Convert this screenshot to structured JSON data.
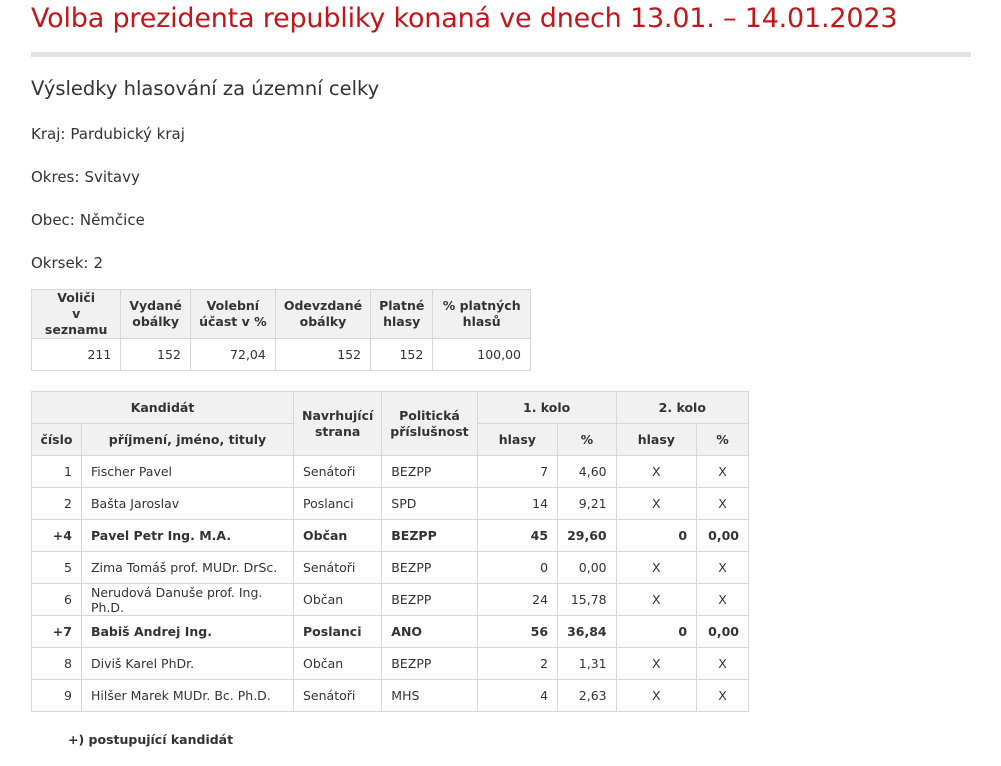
{
  "title": "Volba prezidenta republiky konaná ve dnech 13.01. – 14.01.2023",
  "subtitle": "Výsledky hlasování za územní celky",
  "location": [
    {
      "label": "Kraj:",
      "value": "Pardubický kraj"
    },
    {
      "label": "Okres:",
      "value": "Svitavy"
    },
    {
      "label": "Obec:",
      "value": "Němčice"
    },
    {
      "label": "Okrsek:",
      "value": "2"
    }
  ],
  "summary": {
    "headers": [
      [
        "Voliči",
        "v seznamu"
      ],
      [
        "Vydané",
        "obálky"
      ],
      [
        "Volební",
        "účast v %"
      ],
      [
        "Odevzdané",
        "obálky"
      ],
      [
        "Platné",
        "hlasy"
      ],
      [
        "% platných",
        "hlasů"
      ]
    ],
    "values": [
      "211",
      "152",
      "72,04",
      "152",
      "152",
      "100,00"
    ]
  },
  "results": {
    "header_candidate": "Kandidát",
    "header_number": "číslo",
    "header_name": "příjmení, jméno, tituly",
    "header_party": [
      "Navrhující",
      "strana"
    ],
    "header_affiliation": [
      "Politická",
      "příslušnost"
    ],
    "header_round1": "1. kolo",
    "header_round2": "2. kolo",
    "header_votes": "hlasy",
    "header_percent": "%",
    "rows": [
      {
        "num": "1",
        "name": "Fischer Pavel",
        "party": "Senátoři",
        "affil": "BEZPP",
        "v1": "7",
        "p1": "4,60",
        "v2": "X",
        "p2": "X",
        "bold": false
      },
      {
        "num": "2",
        "name": "Bašta Jaroslav",
        "party": "Poslanci",
        "affil": "SPD",
        "v1": "14",
        "p1": "9,21",
        "v2": "X",
        "p2": "X",
        "bold": false
      },
      {
        "num": "+4",
        "name": "Pavel Petr Ing. M.A.",
        "party": "Občan",
        "affil": "BEZPP",
        "v1": "45",
        "p1": "29,60",
        "v2": "0",
        "p2": "0,00",
        "bold": true
      },
      {
        "num": "5",
        "name": "Zima Tomáš prof. MUDr. DrSc.",
        "party": "Senátoři",
        "affil": "BEZPP",
        "v1": "0",
        "p1": "0,00",
        "v2": "X",
        "p2": "X",
        "bold": false
      },
      {
        "num": "6",
        "name": "Nerudová Danuše prof. Ing. Ph.D.",
        "party": "Občan",
        "affil": "BEZPP",
        "v1": "24",
        "p1": "15,78",
        "v2": "X",
        "p2": "X",
        "bold": false
      },
      {
        "num": "+7",
        "name": "Babiš Andrej Ing.",
        "party": "Poslanci",
        "affil": "ANO",
        "v1": "56",
        "p1": "36,84",
        "v2": "0",
        "p2": "0,00",
        "bold": true
      },
      {
        "num": "8",
        "name": "Diviš Karel PhDr.",
        "party": "Občan",
        "affil": "BEZPP",
        "v1": "2",
        "p1": "1,31",
        "v2": "X",
        "p2": "X",
        "bold": false
      },
      {
        "num": "9",
        "name": "Hilšer Marek MUDr. Bc. Ph.D.",
        "party": "Senátoři",
        "affil": "MHS",
        "v1": "4",
        "p1": "2,63",
        "v2": "X",
        "p2": "X",
        "bold": false
      }
    ]
  },
  "footnote": "+) postupující kandidát",
  "colors": {
    "title_red": "#c0161c",
    "header_bg": "#f1f1f1",
    "border": "#d7d7d7"
  }
}
